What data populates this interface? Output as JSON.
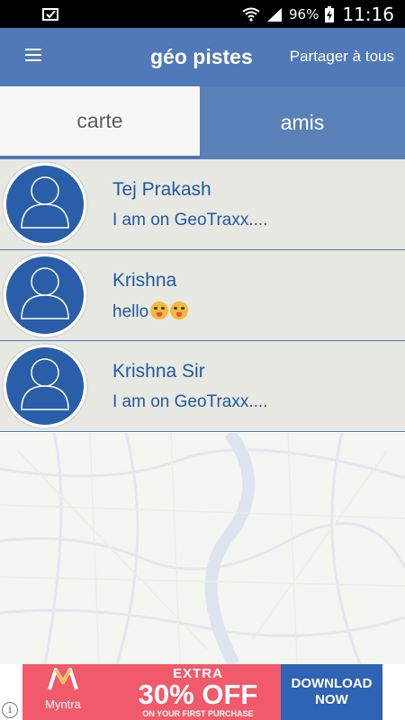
{
  "status_bar": {
    "battery_pct": "96%",
    "time": "11:16"
  },
  "header": {
    "title": "géo pistes",
    "share_action": "Partager à tous"
  },
  "tabs": [
    {
      "label": "carte",
      "selected": false
    },
    {
      "label": "amis",
      "selected": true
    }
  ],
  "friends": [
    {
      "name": "Tej Prakash",
      "status": "I am on GeoTraxx...."
    },
    {
      "name": "Krishna",
      "status": "hello"
    },
    {
      "name": "Krishna Sir",
      "status": "I am on GeoTraxx...."
    }
  ],
  "ad": {
    "brand": "Myntra",
    "headline": "EXTRA",
    "offer": "30% OFF",
    "subline": "ON YOUR FIRST PURCHASE",
    "cta": "DOWNLOAD NOW"
  },
  "colors": {
    "accent": "#4f79b8",
    "tab_selected": "#5a80b8",
    "list_bg": "#e8e8e3",
    "avatar": "#2a5ea8",
    "ad_bg": "#f05a6b",
    "ad_cta": "#2f63b3"
  },
  "icons": [
    "menu-icon",
    "avatar-placeholder-icon",
    "info-icon",
    "myntra-logo",
    "wifi-icon",
    "signal-icon",
    "battery-icon",
    "download-notification-icon"
  ]
}
